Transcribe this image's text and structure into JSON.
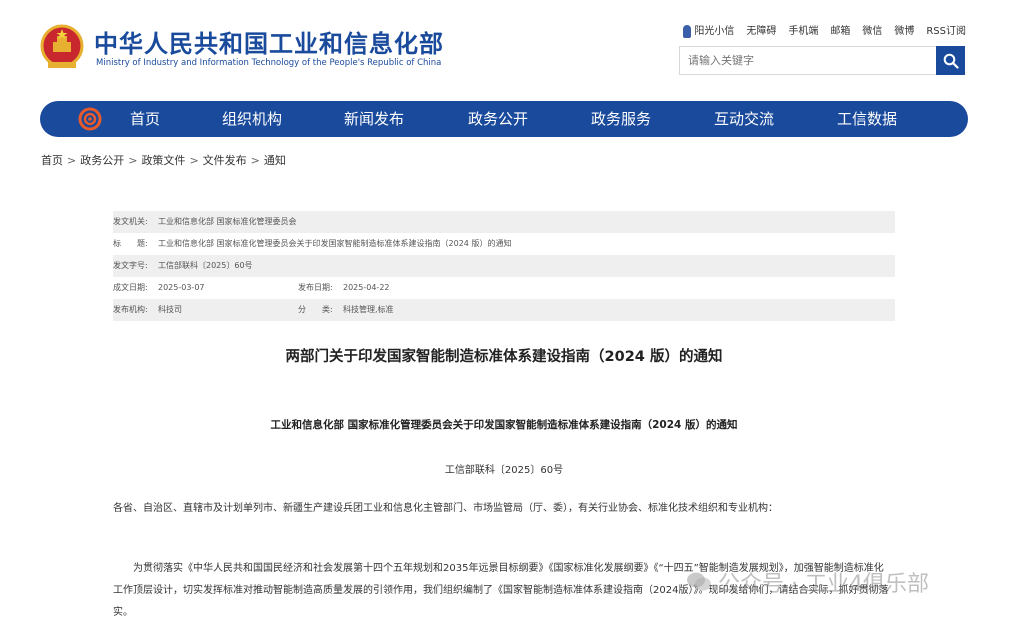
{
  "header": {
    "title_cn": "中华人民共和国工业和信息化部",
    "title_en": "Ministry of Industry and Information Technology of the People's Republic of China",
    "links": [
      "阳光小信",
      "无障碍",
      "手机端",
      "邮箱",
      "微信",
      "微博",
      "RSS订阅"
    ],
    "search_placeholder": "请输入关键字",
    "brand_color": "#1a4a9c"
  },
  "nav": {
    "items": [
      "首页",
      "组织机构",
      "新闻发布",
      "政务公开",
      "政务服务",
      "互动交流",
      "工信数据"
    ]
  },
  "breadcrumb": [
    "首页",
    "政务公开",
    "政策文件",
    "文件发布",
    "通知"
  ],
  "info": {
    "issuer_label": "发文机关:",
    "issuer": "工业和信息化部 国家标准化管理委员会",
    "title_label": "标　　题:",
    "title": "工业和信息化部 国家标准化管理委员会关于印发国家智能制造标准体系建设指南（2024 版）的通知",
    "docno_label": "发文字号:",
    "docno": "工信部联科〔2025〕60号",
    "date_label": "成文日期:",
    "date": "2025-03-07",
    "pubdate_label": "发布日期:",
    "pubdate": "2025-04-22",
    "org_label": "发布机构:",
    "org": "科技司",
    "category_label": "分　　类:",
    "category": "科技管理,标准"
  },
  "article": {
    "main_title": "两部门关于印发国家智能制造标准体系建设指南（2024 版）的通知",
    "sub_title": "工业和信息化部 国家标准化管理委员会关于印发国家智能制造标准体系建设指南（2024 版）的通知",
    "doc_no": "工信部联科〔2025〕60号",
    "para1": "各省、自治区、直辖市及计划单列市、新疆生产建设兵团工业和信息化主管部门、市场监管局（厅、委），有关行业协会、标准化技术组织和专业机构：",
    "para2": "为贯彻落实《中华人民共和国国民经济和社会发展第十四个五年规划和2035年远景目标纲要》《国家标准化发展纲要》《“十四五”智能制造发展规划》，加强智能制造标准化工作顶层设计，切实发挥标准对推动智能制造高质量发展的引领作用，我们组织编制了《国家智能制造标准体系建设指南（2024版）》。现印发给你们，请结合实际，抓好贯彻落实。"
  },
  "watermark": {
    "text": "公众号 · 工业4俱乐部",
    "icon": "wechat-icon"
  }
}
